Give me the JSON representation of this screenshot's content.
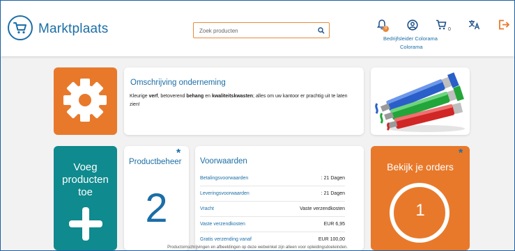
{
  "header": {
    "logo_text": "Marktplaats",
    "search_placeholder": "Zoek producten",
    "notifications_badge": "0",
    "cart_count": "0",
    "user_name": "Bedrijfsleider Colorama",
    "company": "Colorama",
    "icons": [
      "cart-logo-icon",
      "search-icon",
      "bell-icon",
      "user-circle-icon",
      "cart-icon",
      "translate-icon",
      "logout-icon"
    ]
  },
  "description": {
    "title": "Omschrijving onderneming",
    "text_1": "Kleurige ",
    "text_verf": "verf",
    "text_2": ", betoverend ",
    "text_behang": "behang",
    "text_3": " en ",
    "text_kwast": "kwaliteitskwasten",
    "text_4": "; alles om uw kantoor er prachtig uit te laten zien!"
  },
  "add_products": {
    "line1": "Voeg",
    "line2": "producten",
    "line3": "toe"
  },
  "product_management": {
    "title": "Productbeheer",
    "count": "2",
    "star": "*"
  },
  "terms": {
    "title": "Voorwaarden",
    "rows": [
      {
        "key": "Betalingsvoorwaarden",
        "value": ": 21 Dagen"
      },
      {
        "key": "Leveringsvoorwaarden",
        "value": ": 21 Dagen"
      },
      {
        "key": "Vracht",
        "value": "Vaste verzendkosten"
      },
      {
        "key": "Vaste verzendkosten",
        "value": "EUR 6,95"
      },
      {
        "key": "Gratis verzending vanaf",
        "value": "EUR 100,00"
      }
    ]
  },
  "orders": {
    "title": "Bekijk je orders",
    "count": "1",
    "star": "*"
  },
  "footer_note": "Productomschrijvingen en afbeeldingen op deze webwinkel zijn alleen voor opleidingsdoeleinden.",
  "colors": {
    "brand_blue": "#1b6ea6",
    "orange": "#e8792b",
    "teal": "#0f8a8e"
  }
}
